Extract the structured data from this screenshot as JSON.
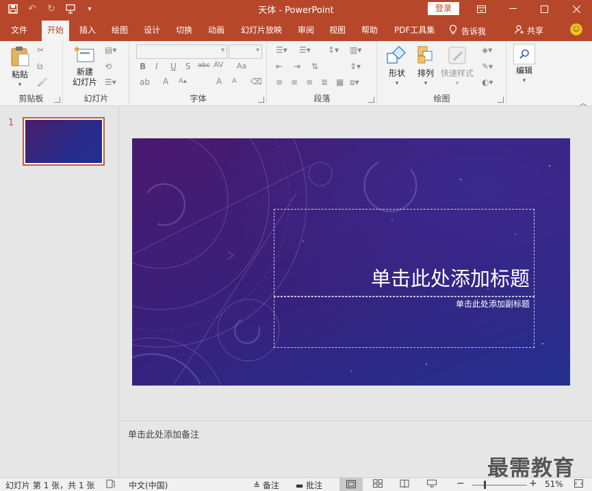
{
  "title_bar": {
    "title": "天体  -  PowerPoint",
    "login_label": "登录",
    "qat_icons": [
      "save-icon",
      "undo-icon",
      "redo-icon",
      "from-beginning-icon",
      "customize-icon"
    ]
  },
  "tabs": [
    {
      "label": "文件"
    },
    {
      "label": "开始",
      "active": true
    },
    {
      "label": "插入"
    },
    {
      "label": "绘图"
    },
    {
      "label": "设计"
    },
    {
      "label": "切换"
    },
    {
      "label": "动画"
    },
    {
      "label": "幻灯片放映"
    },
    {
      "label": "审阅"
    },
    {
      "label": "视图"
    },
    {
      "label": "帮助"
    },
    {
      "label": "PDF工具集"
    }
  ],
  "tell_me": "告诉我",
  "share": "共享",
  "ribbon": {
    "clipboard": {
      "paste": "粘贴",
      "label": "剪贴板"
    },
    "slides": {
      "new_slide_line1": "新建",
      "new_slide_line2": "幻灯片",
      "label": "幻灯片"
    },
    "font": {
      "label": "字体",
      "buttons": [
        "B",
        "I",
        "U",
        "S",
        "abc",
        "AV",
        "Aa",
        "A",
        "A",
        "A"
      ]
    },
    "paragraph": {
      "label": "段落"
    },
    "drawing": {
      "shapes": "形状",
      "arrange": "排列",
      "quick_styles": "快速样式",
      "label": "绘图"
    },
    "editing": {
      "edit": "编辑"
    }
  },
  "thumbnails": [
    {
      "number": "1"
    }
  ],
  "slide": {
    "title_placeholder": "单击此处添加标题",
    "subtitle_placeholder": "单击此处添加副标题"
  },
  "notes_placeholder": "单击此处添加备注",
  "watermark": "最需教育",
  "status_bar": {
    "slide_info": "幻灯片 第 1 张，共 1 张",
    "language": "中文(中国)",
    "notes": "备注",
    "comments": "批注",
    "zoom": "51%",
    "zoom_level": 0.51
  }
}
